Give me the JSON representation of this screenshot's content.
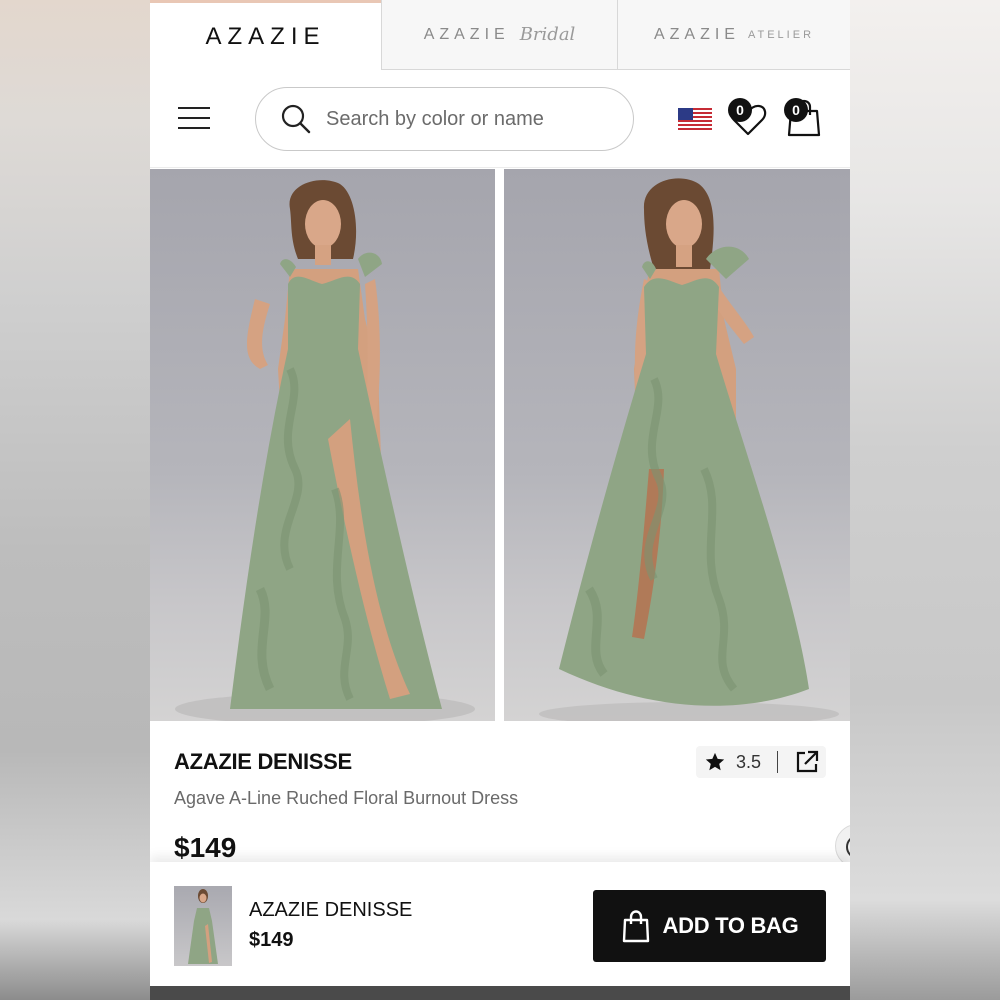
{
  "brand_tabs": [
    {
      "label": "AZAZIE",
      "script": "",
      "suffix": "",
      "active": true
    },
    {
      "label": "AZAZIE",
      "script": "Bridal",
      "suffix": ""
    },
    {
      "label": "AZAZIE",
      "script": "",
      "suffix": "ATELIER"
    }
  ],
  "header": {
    "search_placeholder": "Search by color or name",
    "wishlist_count": "0",
    "bag_count": "0"
  },
  "product": {
    "brand": "AZAZIE DENISSE",
    "name": "Agave A-Line Ruched Floral Burnout Dress",
    "price": "$149",
    "rating": "3.5"
  },
  "sticky_bar": {
    "brand": "AZAZIE DENISSE",
    "price": "$149",
    "add_to_bag_label": "ADD TO BAG"
  },
  "colors": {
    "dress": "#8fa585",
    "accent_tab": "#e9c7b5",
    "button": "#111111"
  }
}
